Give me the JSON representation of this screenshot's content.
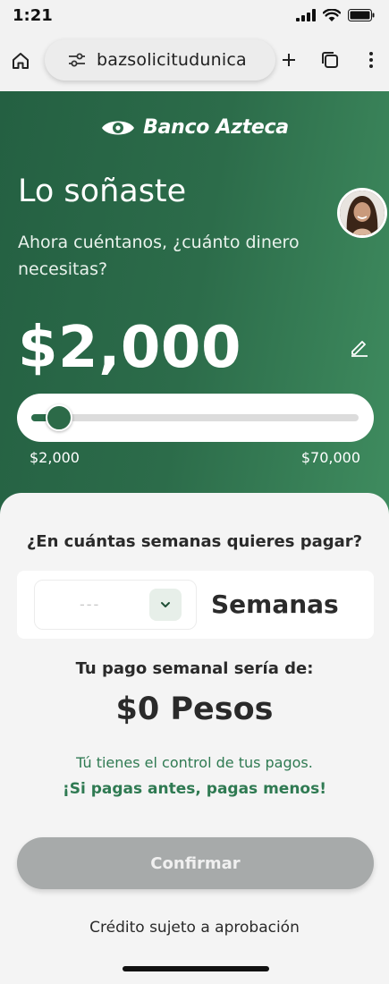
{
  "status_bar": {
    "time": "1:21"
  },
  "browser": {
    "url": "bazsolicitudunica"
  },
  "brand": {
    "name": "Banco Azteca",
    "primary": "#2c6c4a",
    "accent": "#2f7a52"
  },
  "hero": {
    "title": "Lo soñaste",
    "subtitle": "Ahora cuéntanos, ¿cuánto dinero necesitas?",
    "amount": "$2,000",
    "slider": {
      "min_label": "$2,000",
      "max_label": "$70,000",
      "min": 2000,
      "max": 70000,
      "value": 2000
    }
  },
  "sheet": {
    "question": "¿En cuántas semanas quieres pagar?",
    "weeks_placeholder": "---",
    "weeks_label": "Semanas",
    "weekly_payment_label": "Tu pago semanal sería de:",
    "weekly_payment_value": "$0 Pesos",
    "control_text": "Tú tienes el control de tus pagos.",
    "pay_less_text": "¡Si pagas antes, pagas menos!",
    "confirm_label": "Confirmar",
    "credit_note": "Crédito sujeto a aprobación"
  }
}
